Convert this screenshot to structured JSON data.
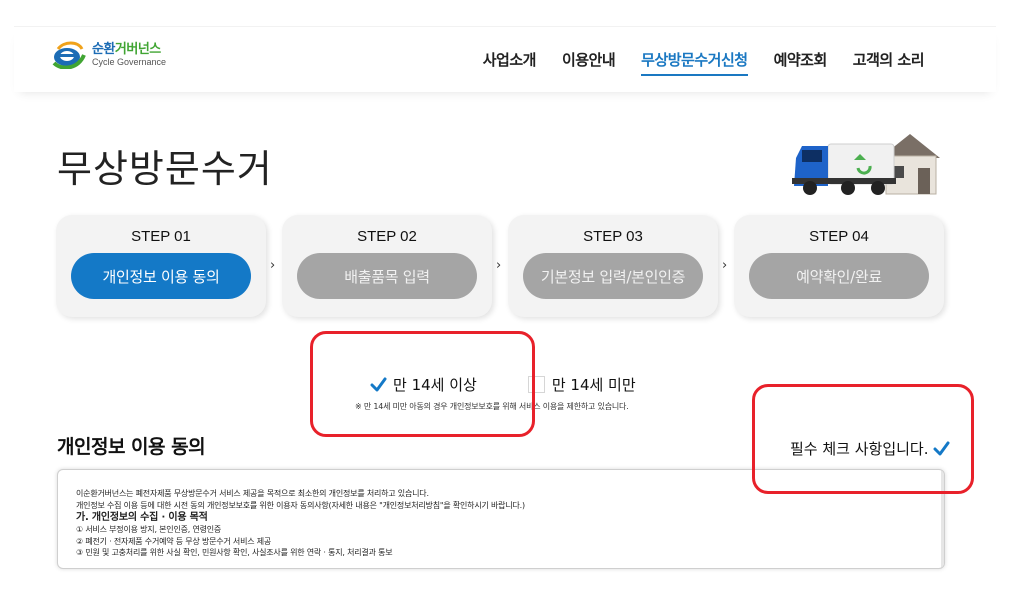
{
  "header": {
    "logo_ko_1": "순환",
    "logo_ko_2": "거버넌스",
    "logo_en": "Cycle Governance",
    "nav": [
      "사업소개",
      "이용안내",
      "무상방문수거신청",
      "예약조회",
      "고객의 소리"
    ],
    "active_nav": "무상방문수거신청"
  },
  "page_title": "무상방문수거",
  "steps": [
    {
      "label": "STEP 01",
      "button": "개인정보 이용 동의",
      "active": true
    },
    {
      "label": "STEP 02",
      "button": "배출품목 입력",
      "active": false
    },
    {
      "label": "STEP 03",
      "button": "기본정보 입력/본인인증",
      "active": false
    },
    {
      "label": "STEP 04",
      "button": "예약확인/완료",
      "active": false
    }
  ],
  "step_arrow": "›",
  "age": {
    "over14_label": "만 14세 이상",
    "over14_checked": true,
    "under14_label": "만 14세 미만",
    "under14_checked": false,
    "notice": "※ 만 14세 미만 아동의 경우 개인정보보호를 위해 서비스 이용을 제한하고 있습니다."
  },
  "consent": {
    "title": "개인정보 이용 동의",
    "required_label": "필수 체크 사항입니다.",
    "required_checked": true,
    "terms": [
      "이순환거버넌스는 폐전자제품 무상방문수거 서비스 제공을 목적으로 최소한의 개인정보를 처리하고 있습니다.",
      "개인정보 수집 이용 등에 대한 시전 동의 개인정보보호를 위한 이용자 동의사항(자세한 내용은 \"개인정보처리방침\"을 확인하시기 바랍니다.)"
    ],
    "subheading": "가. 개인정보의 수집 · 이용 목적",
    "items": [
      "① 서비스 부정이용 방지, 본인인증, 연령인증",
      "② 폐전기 · 전자제품 수거예약 등 무상 방문수거 서비스 제공",
      "③ 민원 및 고충처리를 위한 사실 확인, 민원사항 확인, 사실조사를 위한 연락 · 통지, 처리결과 통보"
    ]
  },
  "colors": {
    "primary": "#1479c7",
    "inactive_pill": "#a5a5a5",
    "highlight": "#e8212a"
  }
}
